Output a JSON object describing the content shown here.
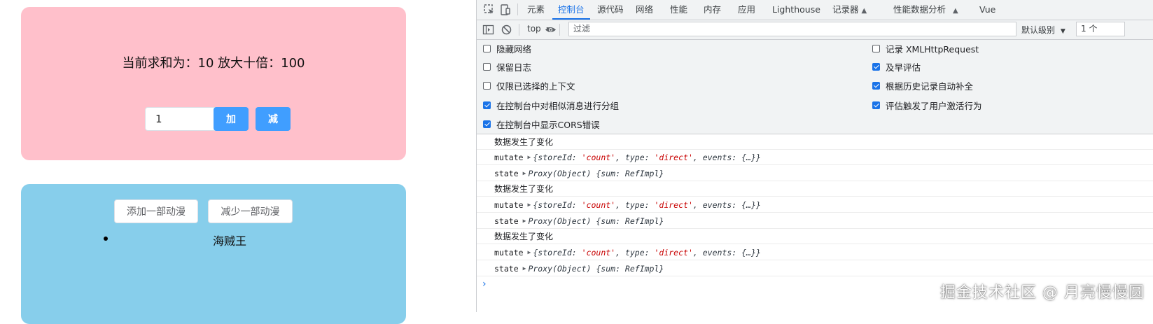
{
  "app": {
    "sum_text": "当前求和为：10 放大十倍：100",
    "select": {
      "value": "1"
    },
    "add_label": "加",
    "sub_label": "减",
    "add_anime_label": "添加一部动漫",
    "remove_anime_label": "减少一部动漫",
    "anime_list": [
      "海贼王"
    ],
    "colors": {
      "pink_card": "#ffc0cb",
      "blue_card": "#87ceeb",
      "primary_button": "#409eff"
    }
  },
  "devtools": {
    "tabs": [
      {
        "label": "元素"
      },
      {
        "label": "控制台",
        "active": true
      },
      {
        "label": "源代码"
      },
      {
        "label": "网络"
      },
      {
        "label": "性能"
      },
      {
        "label": "内存"
      },
      {
        "label": "应用"
      },
      {
        "label": "Lighthouse"
      },
      {
        "label": "记录器"
      },
      {
        "label": "性能数据分析"
      },
      {
        "label": "Vue"
      }
    ],
    "toolbar": {
      "context": "top",
      "filter_placeholder": "过滤",
      "level": "默认级别",
      "issues": "1 个"
    },
    "settings_left": [
      {
        "label": "隐藏网络",
        "checked": false
      },
      {
        "label": "保留日志",
        "checked": false
      },
      {
        "label": "仅限已选择的上下文",
        "checked": false
      },
      {
        "label": "在控制台中对相似消息进行分组",
        "checked": true
      },
      {
        "label": "在控制台中显示CORS错误",
        "checked": true
      }
    ],
    "settings_right": [
      {
        "label": "记录 XMLHttpRequest",
        "checked": false
      },
      {
        "label": "及早评估",
        "checked": true
      },
      {
        "label": "根据历史记录自动补全",
        "checked": true
      },
      {
        "label": "评估触发了用户激活行为",
        "checked": true
      }
    ],
    "logs": [
      {
        "kind": "text",
        "text": "数据发生了变化"
      },
      {
        "kind": "mutate",
        "label": "mutate",
        "store_id": "'count'",
        "type": "'direct'"
      },
      {
        "kind": "state",
        "label": "state",
        "value": "Proxy(Object) {sum: RefImpl}"
      },
      {
        "kind": "text",
        "text": "数据发生了变化"
      },
      {
        "kind": "mutate",
        "label": "mutate",
        "store_id": "'count'",
        "type": "'direct'"
      },
      {
        "kind": "state",
        "label": "state",
        "value": "Proxy(Object) {sum: RefImpl}"
      },
      {
        "kind": "text",
        "text": "数据发生了变化"
      },
      {
        "kind": "mutate",
        "label": "mutate",
        "store_id": "'count'",
        "type": "'direct'"
      },
      {
        "kind": "state",
        "label": "state",
        "value": "Proxy(Object) {sum: RefImpl}"
      }
    ],
    "mutate_labels": {
      "store_id_key": "{storeId: ",
      "type_key": ", type: ",
      "events": ", events: {…}}"
    },
    "prompt": "›"
  },
  "watermark": "掘金技术社区 @ 月亮慢慢圆"
}
